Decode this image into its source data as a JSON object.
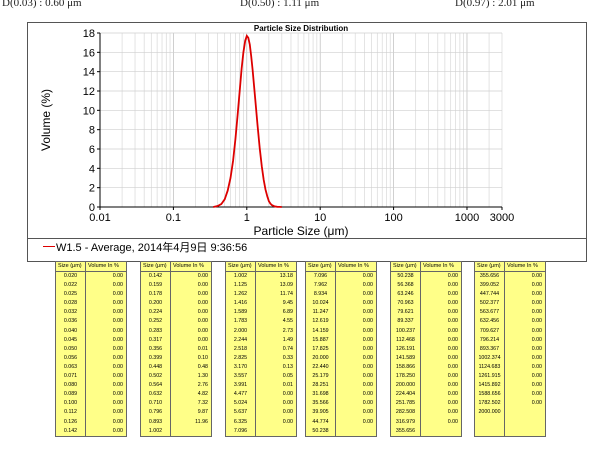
{
  "d_values": [
    "D(0.03) : 0.60 μm",
    "D(0.50) : 1.11 μm",
    "D(0.97) : 2.01 μm"
  ],
  "chart_data": {
    "type": "line",
    "title": "Particle Size Distribution",
    "xlabel": "Particle Size (μm)",
    "ylabel": "Volume (%)",
    "x_scale": "log",
    "xlim": [
      0.01,
      3000
    ],
    "ylim": [
      0,
      18
    ],
    "x_ticks": [
      "0.01",
      "0.1",
      "1",
      "10",
      "100",
      "1000",
      "3000"
    ],
    "y_ticks": [
      "0",
      "2",
      "4",
      "6",
      "8",
      "10",
      "12",
      "14",
      "16",
      "18"
    ],
    "grid": true,
    "series": [
      {
        "name": "W1.5 - Average, 2014年4月9日 9:36:56",
        "color": "#dd0000",
        "x": [
          0.35,
          0.4,
          0.45,
          0.5,
          0.55,
          0.6,
          0.65,
          0.7,
          0.75,
          0.8,
          0.85,
          0.9,
          0.95,
          1.0,
          1.05,
          1.1,
          1.15,
          1.2,
          1.3,
          1.4,
          1.5,
          1.6,
          1.7,
          1.8,
          1.9,
          2.0,
          2.1,
          2.2,
          2.4,
          2.6,
          2.8,
          3.0
        ],
        "y": [
          0,
          0.1,
          0.3,
          0.8,
          1.7,
          3.0,
          4.8,
          7.0,
          9.5,
          12.0,
          14.3,
          16.0,
          17.2,
          17.7,
          17.5,
          16.8,
          15.6,
          14.2,
          11.2,
          8.5,
          6.1,
          4.2,
          2.8,
          1.8,
          1.1,
          0.6,
          0.35,
          0.2,
          0.06,
          0.02,
          0.01,
          0
        ]
      }
    ]
  },
  "legend": {
    "label": "W1.5 - Average, 2014年4月9日 9:36:56"
  },
  "tables": {
    "size_header": "Size (μm)",
    "volume_header": "Volume In %",
    "columns": [
      {
        "rows": [
          [
            "0.020",
            "0.00"
          ],
          [
            "0.022",
            "0.00"
          ],
          [
            "0.025",
            "0.00"
          ],
          [
            "0.028",
            "0.00"
          ],
          [
            "0.032",
            "0.00"
          ],
          [
            "0.036",
            "0.00"
          ],
          [
            "0.040",
            "0.00"
          ],
          [
            "0.045",
            "0.00"
          ],
          [
            "0.050",
            "0.00"
          ],
          [
            "0.056",
            "0.00"
          ],
          [
            "0.063",
            "0.00"
          ],
          [
            "0.071",
            "0.00"
          ],
          [
            "0.080",
            "0.00"
          ],
          [
            "0.089",
            "0.00"
          ],
          [
            "0.100",
            "0.00"
          ],
          [
            "0.112",
            "0.00"
          ],
          [
            "0.126",
            "0.00"
          ],
          [
            "0.142",
            "0.00"
          ]
        ]
      },
      {
        "rows": [
          [
            "0.142",
            "0.00"
          ],
          [
            "0.159",
            "0.00"
          ],
          [
            "0.178",
            "0.00"
          ],
          [
            "0.200",
            "0.00"
          ],
          [
            "0.224",
            "0.00"
          ],
          [
            "0.252",
            "0.00"
          ],
          [
            "0.283",
            "0.00"
          ],
          [
            "0.317",
            "0.00"
          ],
          [
            "0.356",
            "0.01"
          ],
          [
            "0.399",
            "0.10"
          ],
          [
            "0.448",
            "0.48"
          ],
          [
            "0.502",
            "1.30"
          ],
          [
            "0.564",
            "2.76"
          ],
          [
            "0.632",
            "4.82"
          ],
          [
            "0.710",
            "7.32"
          ],
          [
            "0.796",
            "9.87"
          ],
          [
            "0.893",
            "11.96"
          ],
          [
            "1.002",
            ""
          ]
        ]
      },
      {
        "rows": [
          [
            "1.002",
            "13.18"
          ],
          [
            "1.125",
            "13.09"
          ],
          [
            "1.262",
            "11.74"
          ],
          [
            "1.416",
            "9.45"
          ],
          [
            "1.589",
            "6.89"
          ],
          [
            "1.783",
            "4.55"
          ],
          [
            "2.000",
            "2.73"
          ],
          [
            "2.244",
            "1.49"
          ],
          [
            "2.518",
            "0.74"
          ],
          [
            "2.825",
            "0.33"
          ],
          [
            "3.170",
            "0.13"
          ],
          [
            "3.557",
            "0.05"
          ],
          [
            "3.991",
            "0.01"
          ],
          [
            "4.477",
            "0.00"
          ],
          [
            "5.024",
            "0.00"
          ],
          [
            "5.637",
            "0.00"
          ],
          [
            "6.325",
            "0.00"
          ],
          [
            "7.096",
            ""
          ]
        ]
      },
      {
        "rows": [
          [
            "7.096",
            "0.00"
          ],
          [
            "7.962",
            "0.00"
          ],
          [
            "8.934",
            "0.00"
          ],
          [
            "10.024",
            "0.00"
          ],
          [
            "11.247",
            "0.00"
          ],
          [
            "12.619",
            "0.00"
          ],
          [
            "14.159",
            "0.00"
          ],
          [
            "15.887",
            "0.00"
          ],
          [
            "17.825",
            "0.00"
          ],
          [
            "20.000",
            "0.00"
          ],
          [
            "22.440",
            "0.00"
          ],
          [
            "25.179",
            "0.00"
          ],
          [
            "28.251",
            "0.00"
          ],
          [
            "31.698",
            "0.00"
          ],
          [
            "35.566",
            "0.00"
          ],
          [
            "39.905",
            "0.00"
          ],
          [
            "44.774",
            "0.00"
          ],
          [
            "50.238",
            ""
          ]
        ]
      },
      {
        "rows": [
          [
            "50.238",
            "0.00"
          ],
          [
            "56.368",
            "0.00"
          ],
          [
            "63.246",
            "0.00"
          ],
          [
            "70.963",
            "0.00"
          ],
          [
            "79.621",
            "0.00"
          ],
          [
            "89.337",
            "0.00"
          ],
          [
            "100.237",
            "0.00"
          ],
          [
            "112.468",
            "0.00"
          ],
          [
            "126.191",
            "0.00"
          ],
          [
            "141.589",
            "0.00"
          ],
          [
            "158.866",
            "0.00"
          ],
          [
            "178.250",
            "0.00"
          ],
          [
            "200.000",
            "0.00"
          ],
          [
            "224.404",
            "0.00"
          ],
          [
            "251.785",
            "0.00"
          ],
          [
            "282.508",
            "0.00"
          ],
          [
            "316.979",
            "0.00"
          ],
          [
            "355.656",
            ""
          ]
        ]
      },
      {
        "rows": [
          [
            "355.656",
            "0.00"
          ],
          [
            "399.052",
            "0.00"
          ],
          [
            "447.744",
            "0.00"
          ],
          [
            "502.377",
            "0.00"
          ],
          [
            "563.677",
            "0.00"
          ],
          [
            "632.456",
            "0.00"
          ],
          [
            "709.627",
            "0.00"
          ],
          [
            "796.214",
            "0.00"
          ],
          [
            "893.367",
            "0.00"
          ],
          [
            "1002.374",
            "0.00"
          ],
          [
            "1124.683",
            "0.00"
          ],
          [
            "1261.915",
            "0.00"
          ],
          [
            "1415.892",
            "0.00"
          ],
          [
            "1588.656",
            "0.00"
          ],
          [
            "1782.502",
            "0.00"
          ],
          [
            "2000.000",
            ""
          ],
          [
            "",
            ""
          ],
          [
            "",
            ""
          ]
        ]
      }
    ]
  }
}
